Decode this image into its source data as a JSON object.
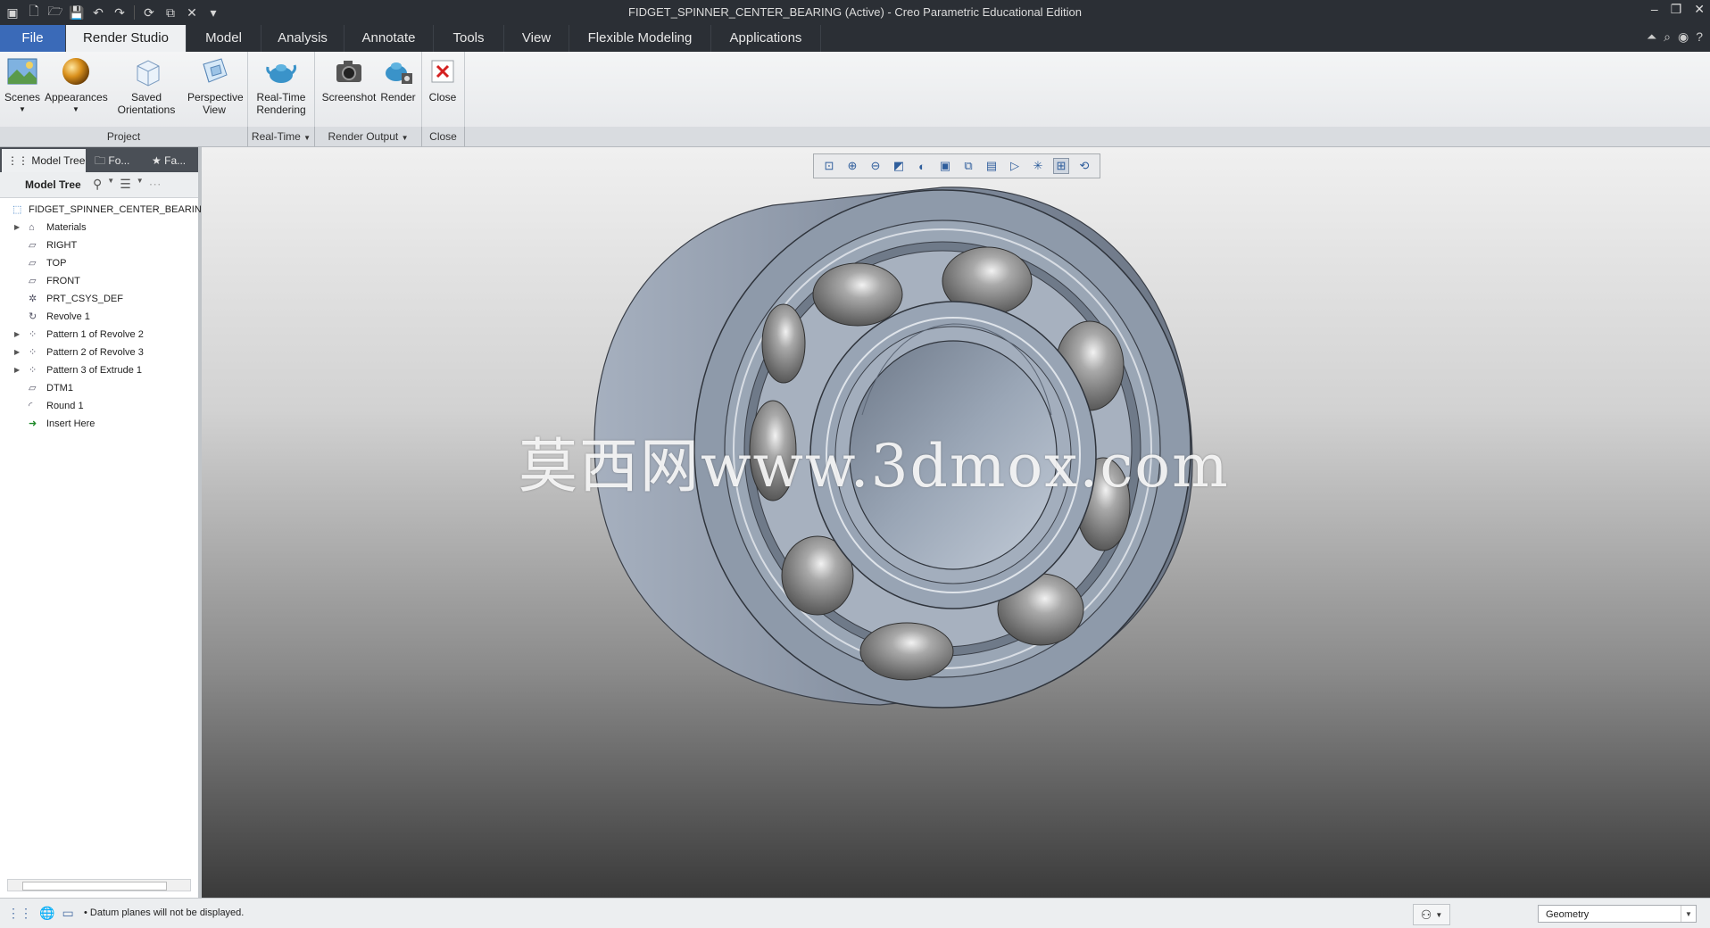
{
  "window": {
    "title": "FIDGET_SPINNER_CENTER_BEARING (Active) - Creo Parametric Educational Edition"
  },
  "tabs": [
    {
      "label": "File"
    },
    {
      "label": "Render Studio"
    },
    {
      "label": "Model"
    },
    {
      "label": "Analysis"
    },
    {
      "label": "Annotate"
    },
    {
      "label": "Tools"
    },
    {
      "label": "View"
    },
    {
      "label": "Flexible Modeling"
    },
    {
      "label": "Applications"
    }
  ],
  "ribbon": {
    "buttons": [
      {
        "label": "Scenes",
        "icon": "scenes-icon"
      },
      {
        "label": "Appearances",
        "icon": "appearances-icon"
      },
      {
        "label": "Saved Orientations",
        "icon": "saved-orientations-icon"
      },
      {
        "label": "Perspective View",
        "icon": "perspective-view-icon"
      },
      {
        "label": "Real-Time Rendering",
        "icon": "real-time-rendering-icon"
      },
      {
        "label": "Screenshot",
        "icon": "camera-icon"
      },
      {
        "label": "Render",
        "icon": "render-icon"
      },
      {
        "label": "Close",
        "icon": "close-icon"
      }
    ],
    "groups": [
      {
        "label": "Project"
      },
      {
        "label": "Real-Time"
      },
      {
        "label": "Render Output"
      },
      {
        "label": "Close"
      }
    ]
  },
  "panel": {
    "tabs": [
      {
        "label": "Model Tree"
      },
      {
        "label": "Fo..."
      },
      {
        "label": "Fa..."
      }
    ],
    "tree_title": "Model Tree",
    "items": [
      {
        "label": "FIDGET_SPINNER_CENTER_BEARING.",
        "icon": "part-icon",
        "expandable": false
      },
      {
        "label": "Materials",
        "icon": "materials-icon",
        "expandable": true
      },
      {
        "label": "RIGHT",
        "icon": "datum-plane-icon",
        "expandable": false
      },
      {
        "label": "TOP",
        "icon": "datum-plane-icon",
        "expandable": false
      },
      {
        "label": "FRONT",
        "icon": "datum-plane-icon",
        "expandable": false
      },
      {
        "label": "PRT_CSYS_DEF",
        "icon": "csys-icon",
        "expandable": false
      },
      {
        "label": "Revolve 1",
        "icon": "revolve-icon",
        "expandable": false
      },
      {
        "label": "Pattern 1 of Revolve 2",
        "icon": "pattern-icon",
        "expandable": true
      },
      {
        "label": "Pattern 2 of Revolve 3",
        "icon": "pattern-icon",
        "expandable": true
      },
      {
        "label": "Pattern 3 of Extrude 1",
        "icon": "pattern-icon",
        "expandable": true
      },
      {
        "label": "DTM1",
        "icon": "datum-plane-icon",
        "expandable": false
      },
      {
        "label": "Round 1",
        "icon": "round-icon",
        "expandable": false
      },
      {
        "label": "Insert Here",
        "icon": "insert-arrow-icon",
        "expandable": false
      }
    ]
  },
  "viewport": {
    "watermark": "莫西网www.3dmox.com"
  },
  "status": {
    "message": "Datum planes will not be displayed.",
    "filter": "Geometry"
  },
  "colors": {
    "accent": "#3a6ab8",
    "titlebar": "#2b2f35",
    "bearing": "#8e9aaa"
  }
}
